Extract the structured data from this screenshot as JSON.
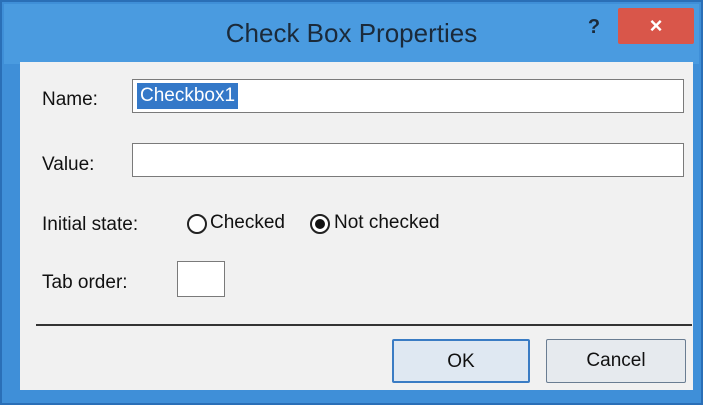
{
  "window": {
    "title": "Check Box Properties",
    "help_label": "?",
    "close_label": "×"
  },
  "fields": {
    "name_label": "Name:",
    "name_value": "Checkbox1",
    "value_label": "Value:",
    "value_value": "",
    "initial_state_label": "Initial state:",
    "checked_label": "Checked",
    "not_checked_label": "Not checked",
    "selected_state": "Not checked",
    "tab_order_label": "Tab order:",
    "tab_order_value": ""
  },
  "buttons": {
    "ok_label": "OK",
    "cancel_label": "Cancel"
  },
  "colors": {
    "title_bar": "#4a9be0",
    "close_button": "#d9564a",
    "selection": "#3478c8"
  }
}
